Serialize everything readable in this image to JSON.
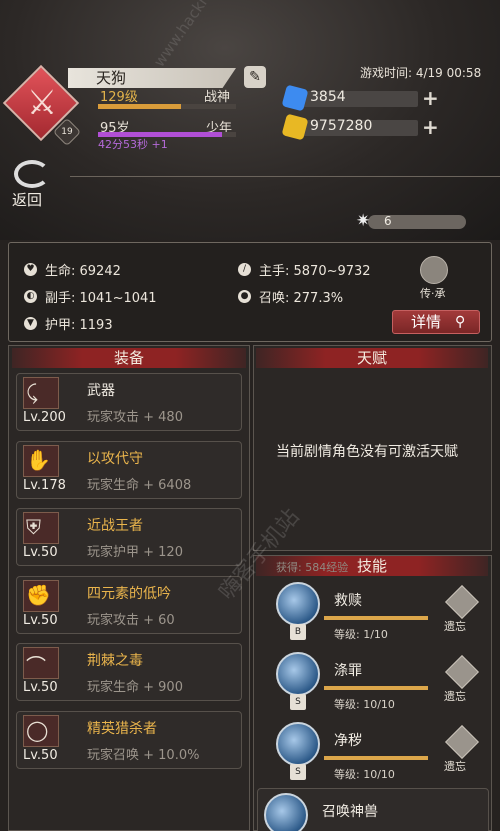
{
  "player": {
    "name": "天狗",
    "level_text": "129级",
    "level_title": "战神",
    "level_progress": 0.6,
    "age_text": "95岁",
    "age_title": "少年",
    "age_progress": 0.9,
    "timer_text": "42分53秒 +1",
    "badge_level": "19"
  },
  "game_time": "游戏时间: 4/19 00:58",
  "currencies": [
    {
      "name": "blue-gem",
      "value": "3854",
      "color": "#3d8bf0"
    },
    {
      "name": "gold-gem",
      "value": "9757280",
      "color": "#e8b824"
    }
  ],
  "back_label": "返回",
  "energy_value": "6",
  "stats": {
    "life": "生命: 69242",
    "main_hand": "主手: 5870~9732",
    "off_hand": "副手: 1041~1041",
    "summon": "召唤: 277.3%",
    "armor": "护甲: 1193"
  },
  "inherit_label": "传·承",
  "detail_label": "详情",
  "sections": {
    "equipment": "装备",
    "talent": "天赋",
    "skills": "技能"
  },
  "talent_text": "当前剧情角色没有可激活天赋",
  "reward_text": "获得: 584经验",
  "equipment": [
    {
      "icon": "bow-icon",
      "level": "Lv.200",
      "name": "武器",
      "stat": "玩家攻击 + 480",
      "color": "#f0ebe2"
    },
    {
      "icon": "glove-icon",
      "level": "Lv.178",
      "name": "以攻代守",
      "stat": "玩家生命 + 6408",
      "color": "#e9b44c"
    },
    {
      "icon": "armor-icon",
      "level": "Lv.50",
      "name": "近战王者",
      "stat": "玩家护甲 + 120",
      "color": "#e9b44c"
    },
    {
      "icon": "gauntlet-icon",
      "level": "Lv.50",
      "name": "四元素的低吟",
      "stat": "玩家攻击 + 60",
      "color": "#e9b44c"
    },
    {
      "icon": "boots-icon",
      "level": "Lv.50",
      "name": "荆棘之毒",
      "stat": "玩家生命 + 900",
      "color": "#e9b44c"
    },
    {
      "icon": "ring-icon",
      "level": "Lv.50",
      "name": "精英猎杀者",
      "stat": "玩家召唤 + 10.0%",
      "color": "#e9b44c"
    }
  ],
  "skills": [
    {
      "name": "救赎",
      "tag": "B",
      "level": "等级: 1/10",
      "forget": "遗忘"
    },
    {
      "name": "涤罪",
      "tag": "S",
      "level": "等级: 10/10",
      "forget": "遗忘"
    },
    {
      "name": "净秽",
      "tag": "S",
      "level": "等级: 10/10",
      "forget": "遗忘"
    },
    {
      "name": "召唤神兽",
      "tag": "",
      "level": "",
      "forget": ""
    }
  ],
  "watermarks": [
    "www.hackhome.com",
    "嗨客手机站"
  ]
}
